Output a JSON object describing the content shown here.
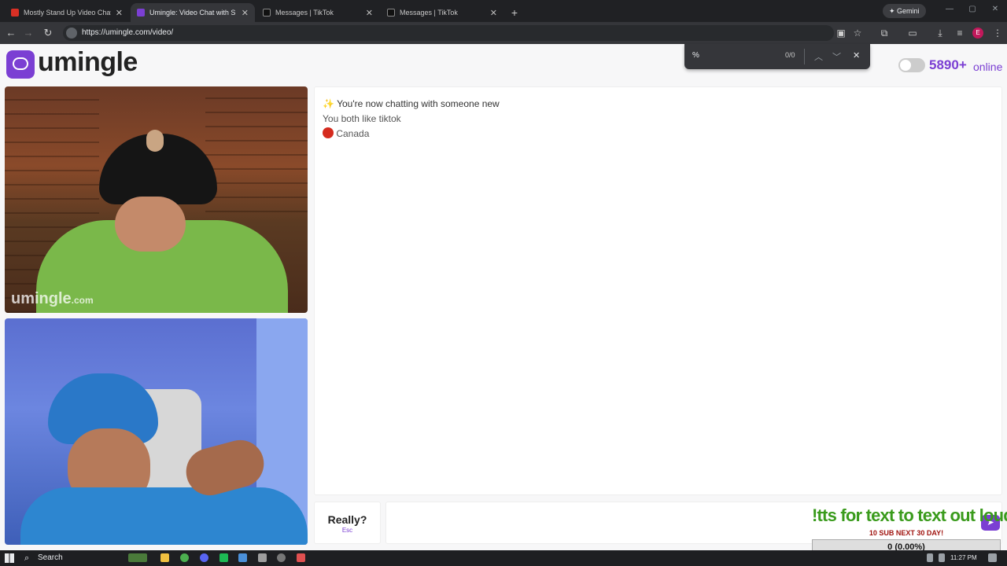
{
  "browser": {
    "tabs": [
      {
        "title": "Mostly Stand Up Video Chat",
        "active": false,
        "fav_color": "#d93025"
      },
      {
        "title": "Umingle: Video Chat with S",
        "active": true,
        "fav_color": "#7b3fd3"
      },
      {
        "title": "Messages | TikTok",
        "active": false,
        "fav_color": "#111111"
      },
      {
        "title": "Messages | TikTok",
        "active": false,
        "fav_color": "#111111"
      }
    ],
    "new_tab": "+",
    "url": "https://umingle.com/video/",
    "gemini_label": "Gemini",
    "profile_initial": "E"
  },
  "find_bar": {
    "query": "%",
    "count": "0/0"
  },
  "header": {
    "logo_text": "umingle",
    "online_count": "5890+",
    "online_label": "online"
  },
  "videos": {
    "watermark_main": "umingle",
    "watermark_suffix": ".com"
  },
  "chat": {
    "lines": [
      "You're now chatting with someone new",
      "You both like tiktok",
      "Canada"
    ],
    "esc_button_label": "Really?",
    "esc_button_hint": "Esc"
  },
  "overlay": {
    "title": "!tts for text to text out loud",
    "subtitle": "10 SUB NEXT 30 DAY!",
    "progress_text": "0 (0.00%)"
  },
  "taskbar": {
    "search_label": "Search",
    "time": "11:27 PM"
  },
  "colors": {
    "brand": "#7b3fd3",
    "overlay_green": "#3a9b1c",
    "overlay_red": "#a0140f"
  }
}
